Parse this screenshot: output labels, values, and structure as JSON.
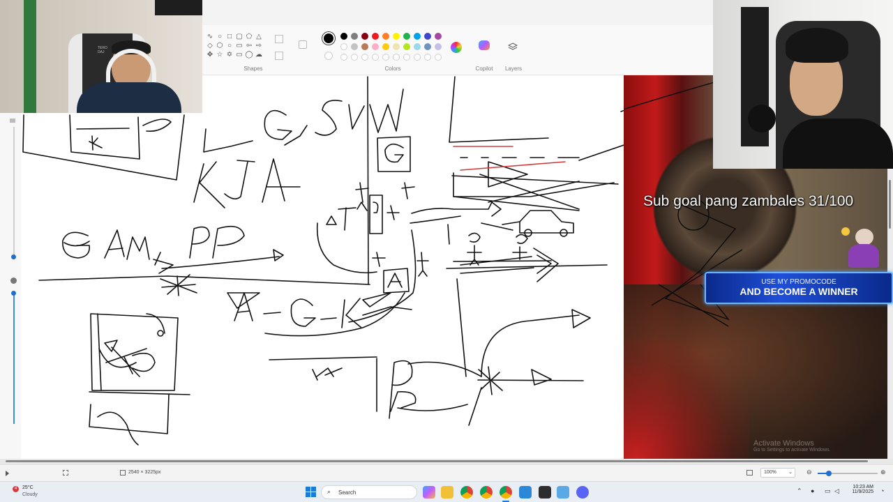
{
  "ribbon": {
    "groups": [
      {
        "label": "Shapes"
      },
      {
        "label": "Colors"
      },
      {
        "label": "Copilot"
      },
      {
        "label": "Layers"
      }
    ],
    "colors_row1": [
      "#000000",
      "#7f7f7f",
      "#880015",
      "#ed1c24",
      "#ff7f27",
      "#fff200",
      "#22b14c",
      "#00a2e8",
      "#3f48cc",
      "#a349a4"
    ],
    "colors_row2": [
      "#ffffff",
      "#c3c3c3",
      "#b97a57",
      "#ffaec9",
      "#ffc90e",
      "#efe4b0",
      "#b5e61d",
      "#99d9ea",
      "#7092be",
      "#c8bfe7"
    ]
  },
  "overlay": {
    "sub_goal_text": "Sub goal pang zambales 31/100",
    "promo_line1": "USE MY PROMOCODE",
    "promo_line2": "AND BECOME A WINNER",
    "watermark_line1": "Activate Windows",
    "watermark_line2": "Go to Settings to activate Windows."
  },
  "webcam_left": {
    "chair_text": "TERO\nDAJ"
  },
  "statusbar": {
    "dimensions": "2540 × 3225px",
    "zoom": "100%"
  },
  "taskbar": {
    "weather_temp": "25°C",
    "weather_desc": "Cloudy",
    "search_label": "Search",
    "time": "10:23 AM",
    "date": "11/9/2025",
    "badge_count": "4"
  }
}
